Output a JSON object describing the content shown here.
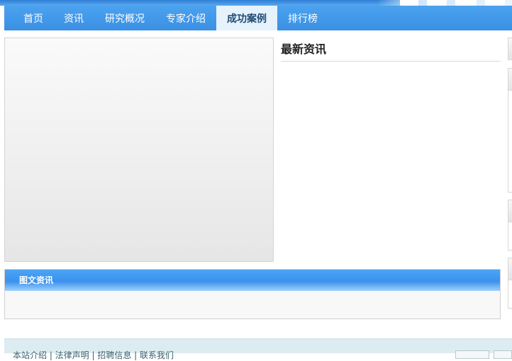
{
  "nav": {
    "items": [
      {
        "label": "首页"
      },
      {
        "label": "资讯"
      },
      {
        "label": "研究概况"
      },
      {
        "label": "专家介绍"
      },
      {
        "label": "成功案例",
        "active": true
      },
      {
        "label": "排行榜"
      }
    ]
  },
  "news": {
    "title": "最新资讯"
  },
  "pic_news": {
    "title": "图文资讯"
  },
  "footer": {
    "links": "本站介绍 | 法律声明 | 招聘信息 | 联系我们"
  }
}
